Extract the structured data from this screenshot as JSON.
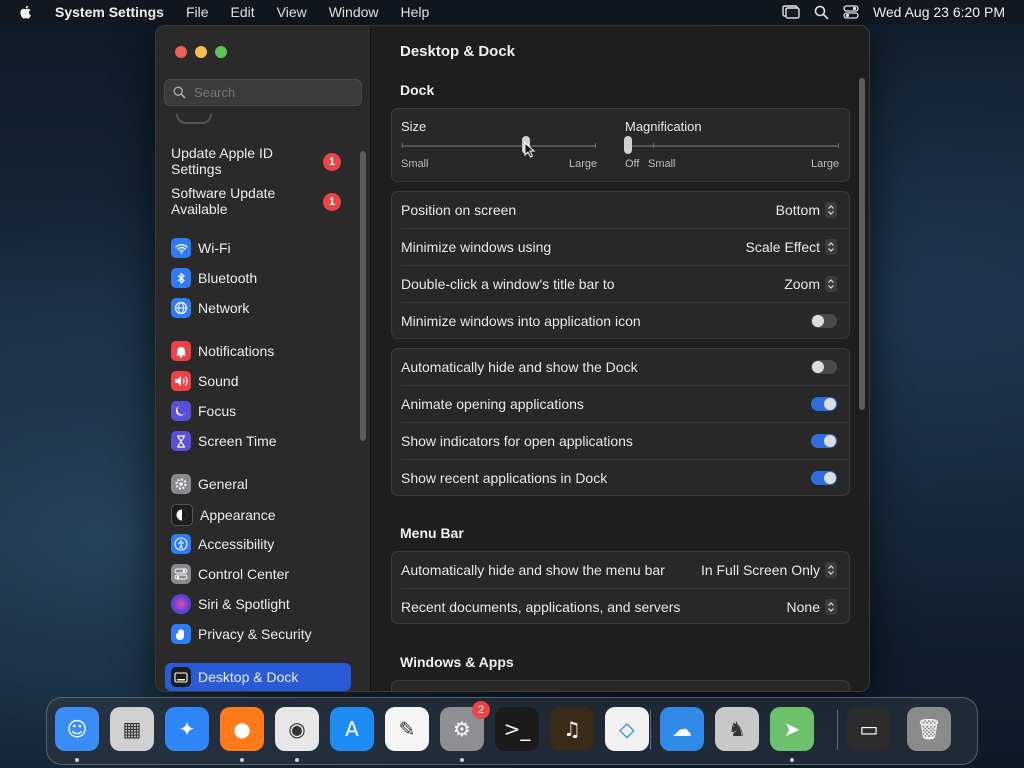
{
  "menubar": {
    "app_name": "System Settings",
    "menus": [
      "File",
      "Edit",
      "View",
      "Window",
      "Help"
    ],
    "datetime": "Wed Aug 23  6:20 PM"
  },
  "sidebar": {
    "search_placeholder": "Search",
    "notices": [
      {
        "label_line1": "Update Apple ID",
        "label_line2": "Settings",
        "badge": "1"
      },
      {
        "label_line1": "Software Update",
        "label_line2": "Available",
        "badge": "1"
      }
    ],
    "items": [
      {
        "label": "Wi-Fi",
        "icon": "wifi-icon",
        "color": "#2f7cf6"
      },
      {
        "label": "Bluetooth",
        "icon": "bluetooth-icon",
        "color": "#2f7cf6"
      },
      {
        "label": "Network",
        "icon": "globe-icon",
        "color": "#2f7cf6"
      },
      {
        "label": "Notifications",
        "icon": "bell-icon",
        "color": "#ec4346"
      },
      {
        "label": "Sound",
        "icon": "speaker-icon",
        "color": "#ec4346"
      },
      {
        "label": "Focus",
        "icon": "moon-icon",
        "color": "#5a4fd6"
      },
      {
        "label": "Screen Time",
        "icon": "hourglass-icon",
        "color": "#5a4fd6"
      },
      {
        "label": "General",
        "icon": "gear-icon",
        "color": "#8a8a8e"
      },
      {
        "label": "Appearance",
        "icon": "appearance-icon",
        "color": "#1c1c1c"
      },
      {
        "label": "Accessibility",
        "icon": "accessibility-icon",
        "color": "#2f7cf6"
      },
      {
        "label": "Control Center",
        "icon": "control-center-icon",
        "color": "#8a8a8e"
      },
      {
        "label": "Siri & Spotlight",
        "icon": "siri-icon",
        "color": "#7b3fe4"
      },
      {
        "label": "Privacy & Security",
        "icon": "hand-icon",
        "color": "#2f7cf6"
      },
      {
        "label": "Desktop & Dock",
        "icon": "desktop-dock-icon",
        "color": "#1c1c1c"
      }
    ],
    "selected": "Desktop & Dock"
  },
  "content": {
    "title": "Desktop & Dock",
    "dock_section": "Dock",
    "size": {
      "label": "Size",
      "min_label": "Small",
      "max_label": "Large",
      "value": 0.6
    },
    "magnification": {
      "label": "Magnification",
      "off_label": "Off",
      "min_label": "Small",
      "max_label": "Large",
      "value": 0.0
    },
    "dock_options": [
      {
        "label": "Position on screen",
        "value": "Bottom"
      },
      {
        "label": "Minimize windows using",
        "value": "Scale Effect"
      },
      {
        "label": "Double-click a window's title bar to",
        "value": "Zoom"
      }
    ],
    "minimize_into_icon": {
      "label": "Minimize windows into application icon",
      "on": false
    },
    "dock_toggles": [
      {
        "label": "Automatically hide and show the Dock",
        "on": false
      },
      {
        "label": "Animate opening applications",
        "on": true
      },
      {
        "label": "Show indicators for open applications",
        "on": true
      },
      {
        "label": "Show recent applications in Dock",
        "on": true
      }
    ],
    "menubar_section": "Menu Bar",
    "menubar_options": [
      {
        "label": "Automatically hide and show the menu bar",
        "value": "In Full Screen Only"
      },
      {
        "label": "Recent documents, applications, and servers",
        "value": "None"
      }
    ],
    "windows_section": "Windows & Apps"
  },
  "dock": {
    "apps": [
      {
        "name": "Finder",
        "icon": "finder-icon",
        "color": "#3a8df5"
      },
      {
        "name": "Launchpad",
        "icon": "launchpad-icon",
        "color": "#d0d0d0"
      },
      {
        "name": "Safari",
        "icon": "safari-icon",
        "color": "#2f86f6"
      },
      {
        "name": "Firefox",
        "icon": "firefox-icon",
        "color": "#ff7a1a"
      },
      {
        "name": "Chrome",
        "icon": "chrome-icon",
        "color": "#e7e7e7"
      },
      {
        "name": "App Store",
        "icon": "app-store-icon",
        "color": "#1f8bf5"
      },
      {
        "name": "TextEdit",
        "icon": "textedit-icon",
        "color": "#f5f5f5"
      },
      {
        "name": "System Settings",
        "icon": "system-settings-icon",
        "color": "#8e8e93",
        "badge": "2"
      },
      {
        "name": "Terminal",
        "icon": "terminal-icon",
        "color": "#1b1b1b"
      },
      {
        "name": "GarageBand",
        "icon": "garageband-icon",
        "color": "#3a2a1a"
      },
      {
        "name": "Visual Studio Code",
        "icon": "vscode-icon",
        "color": "#f2f2f2"
      },
      {
        "name": "Weather",
        "icon": "weather-icon",
        "color": "#2f8ae8"
      },
      {
        "name": "Chess",
        "icon": "chess-icon",
        "color": "#c8c8c8"
      },
      {
        "name": "Maps",
        "icon": "maps-icon",
        "color": "#6bc26b"
      },
      {
        "name": "Chrome Window",
        "icon": "minimized-window-icon",
        "color": "#2c2c2c"
      },
      {
        "name": "Trash",
        "icon": "trash-icon",
        "color": "#8a8a8a"
      }
    ]
  }
}
